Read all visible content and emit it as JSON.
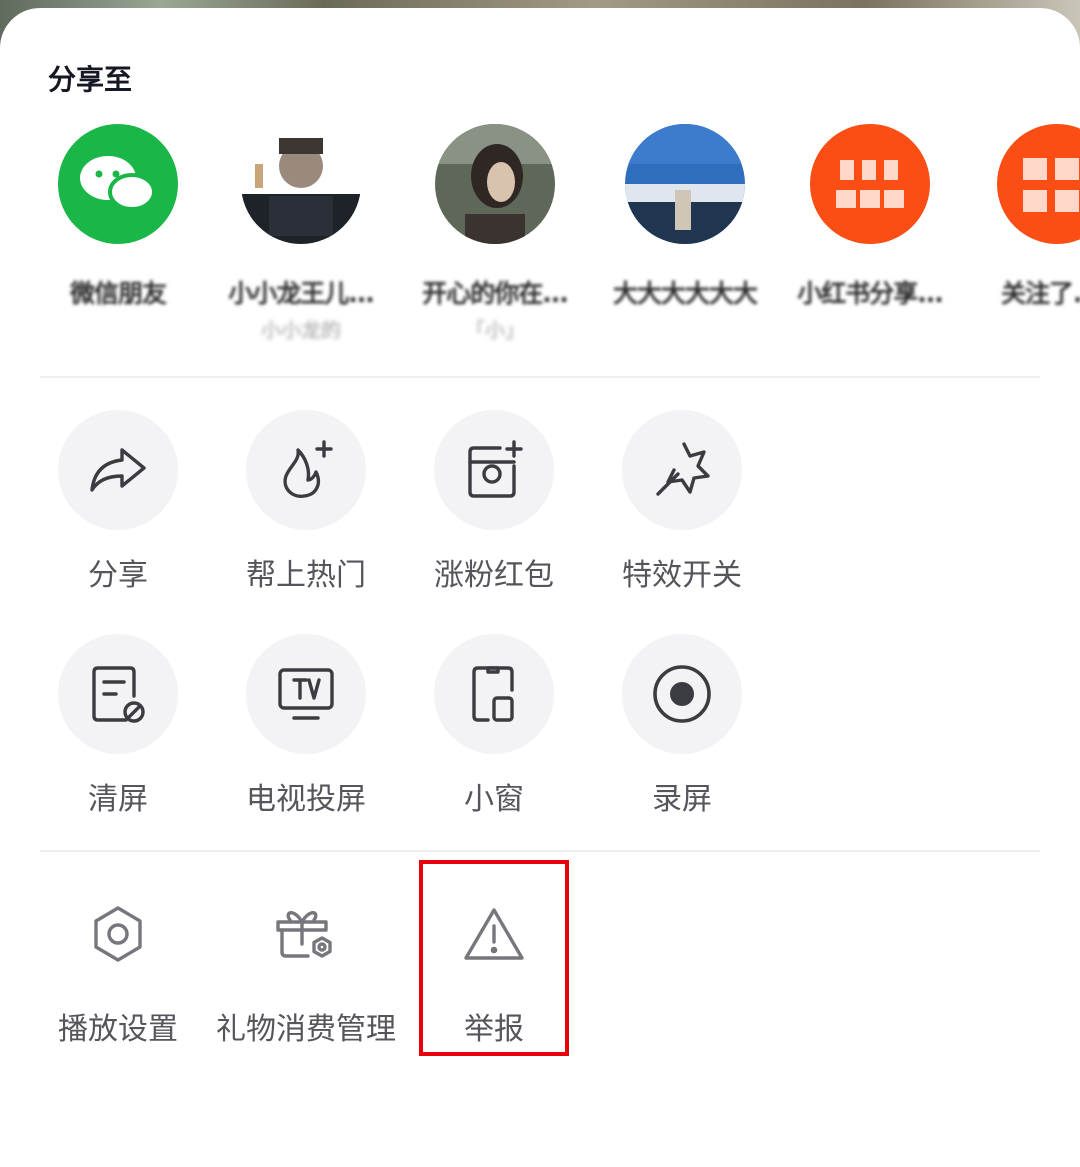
{
  "share": {
    "title": "分享至",
    "contacts": [
      {
        "name": "微信朋友",
        "sub": "",
        "kind": "wechat"
      },
      {
        "name": "小小龙王儿...",
        "sub": "小小龙的",
        "kind": "photo-man"
      },
      {
        "name": "开心的你在...",
        "sub": "「小」",
        "kind": "photo-woman"
      },
      {
        "name": "大大大大大大",
        "sub": "",
        "kind": "photo-sky"
      },
      {
        "name": "小红书分享...",
        "sub": "",
        "kind": "orange"
      },
      {
        "name": "关注了...",
        "sub": "",
        "kind": "orange2"
      }
    ]
  },
  "actions_row1": [
    {
      "label": "分享",
      "icon": "share-arrow-icon"
    },
    {
      "label": "帮上热门",
      "icon": "flame-plus-icon"
    },
    {
      "label": "涨粉红包",
      "icon": "photo-plus-icon"
    },
    {
      "label": "特效开关",
      "icon": "magic-wand-icon"
    }
  ],
  "actions_row2": [
    {
      "label": "清屏",
      "icon": "clear-screen-icon"
    },
    {
      "label": "电视投屏",
      "icon": "tv-cast-icon"
    },
    {
      "label": "小窗",
      "icon": "mini-window-icon"
    },
    {
      "label": "录屏",
      "icon": "record-icon"
    }
  ],
  "settings_row": [
    {
      "label": "播放设置",
      "icon": "hex-gear-icon"
    },
    {
      "label": "礼物消费管理",
      "icon": "gift-gear-icon"
    },
    {
      "label": "举报",
      "icon": "warning-triangle-icon"
    }
  ],
  "colors": {
    "highlight": "#e8000b",
    "wechat": "#1bb648",
    "orange": "#fb4e14"
  }
}
